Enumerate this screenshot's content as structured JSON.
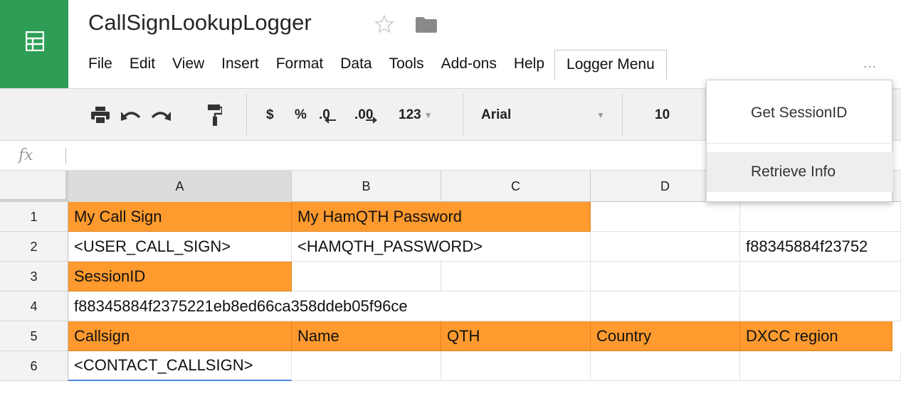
{
  "document": {
    "title": "CallSignLookupLogger"
  },
  "menu": {
    "items": [
      "File",
      "Edit",
      "View",
      "Insert",
      "Format",
      "Data",
      "Tools",
      "Add-ons",
      "Help"
    ],
    "active": "Logger Menu",
    "more": "…"
  },
  "toolbar": {
    "currency": "$",
    "percent": "%",
    "dec_decrease": ".0",
    "dec_increase": ".00",
    "number_format": "123",
    "font": "Arial",
    "font_size": "10"
  },
  "formula_bar": {
    "fx": "fx",
    "value": ""
  },
  "columns": [
    "A",
    "B",
    "C",
    "D"
  ],
  "rows": [
    "1",
    "2",
    "3",
    "4",
    "5",
    "6"
  ],
  "cells": {
    "A1": "My Call Sign",
    "B1": "My HamQTH Password",
    "A2": "<USER_CALL_SIGN>",
    "B2": "<HAMQTH_PASSWORD>",
    "E2": "f88345884f23752",
    "A3": "SessionID",
    "A4": "f88345884f2375221eb8ed66ca358ddeb05f96ce",
    "A5": "Callsign",
    "B5": "Name",
    "C5": "QTH",
    "D5": "Country",
    "E5": "DXCC region",
    "A6": "<CONTACT_CALLSIGN>"
  },
  "dropdown": {
    "items": [
      "Get SessionID",
      "Retrieve Info"
    ]
  },
  "colors": {
    "accent_green": "#2e9e57",
    "cell_orange": "#ff9a2e",
    "selection_blue": "#4a86e8"
  }
}
